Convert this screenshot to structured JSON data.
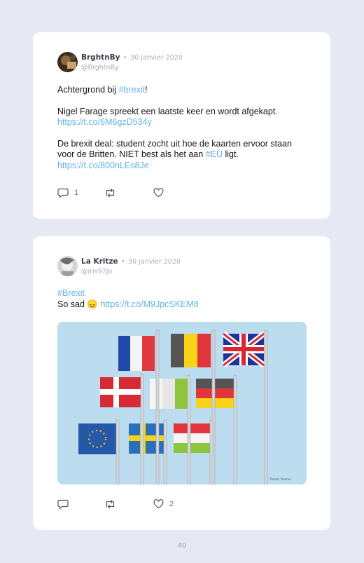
{
  "tweets": [
    {
      "display_name": "BrghtnBy",
      "separator": "•",
      "date": "30 janvier 2020",
      "handle": "@BrghtnBy",
      "p1_text": "Achtergrond bij ",
      "p1_hashtag": "#brexit",
      "p1_end": "!",
      "p2_text": "Nigel Farage spreekt een laatste keer en wordt afgekapt.",
      "p2_link": "https://t.co/6M6gzD534y",
      "p3_text": "De brexit deal: student zocht uit hoe de kaarten ervoor staan voor de Britten. NIET best als het aan ",
      "p3_hashtag": "#EU",
      "p3_end": " ligt.",
      "p3_link": "https://t.co/800nLEs8Je",
      "reply_count": "1",
      "retweet_count": "",
      "like_count": ""
    },
    {
      "display_name": "La Kritze",
      "separator": "•",
      "date": "30 janvier 2020",
      "handle": "@iris97Jo",
      "hashtag": "#Brexit",
      "text": "So sad ",
      "emoji": "😞",
      "link": "https://t.co/M9JpcSKEM8",
      "reply_count": "",
      "retweet_count": "",
      "like_count": "2",
      "image_credit": "Tomás Pedres"
    }
  ],
  "page_number": "40",
  "icons": {
    "reply": "reply-icon",
    "retweet": "retweet-icon",
    "like": "heart-icon"
  },
  "colors": {
    "background": "#e6e8f4",
    "card": "#ffffff",
    "link": "#5fb3e8",
    "muted": "#a9adb8"
  }
}
